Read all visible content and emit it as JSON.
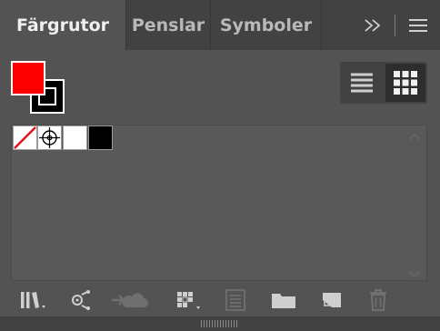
{
  "tabs": [
    {
      "label": "Färgrutor",
      "active": true
    },
    {
      "label": "Penslar",
      "active": false
    },
    {
      "label": "Symboler",
      "active": false
    }
  ],
  "tab_menu_icons": {
    "overflow": "double-chevron-right-icon",
    "menu": "hamburger-menu-icon"
  },
  "fill_stroke": {
    "fill_color": "#ff0000",
    "stroke_color": "#000000"
  },
  "view_toggle": {
    "list_view": "list-view-icon",
    "thumbnail_view": "grid-view-icon",
    "selected": "thumbnail"
  },
  "swatches": [
    {
      "name": "none-swatch",
      "color": "none"
    },
    {
      "name": "registration-swatch",
      "color": "registration"
    },
    {
      "name": "white-swatch",
      "color": "#ffffff"
    },
    {
      "name": "black-swatch",
      "color": "#000000"
    }
  ],
  "bottom_toolbar": [
    "swatch-libraries-icon",
    "show-swatch-kinds-icon",
    "cloud-sync-icon",
    "swatch-options-icon",
    "new-color-group-icon",
    "new-folder-icon",
    "new-swatch-icon",
    "delete-swatch-icon"
  ]
}
